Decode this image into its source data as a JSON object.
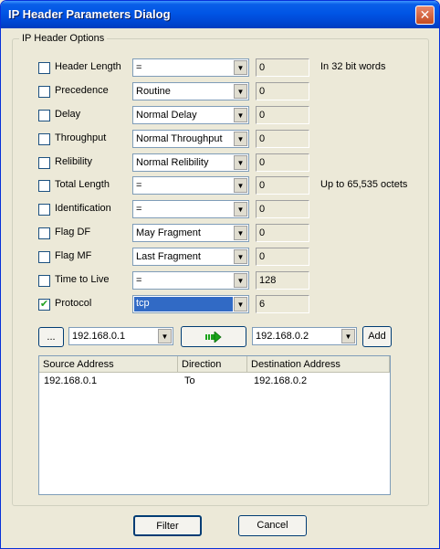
{
  "window": {
    "title": "IP Header Parameters Dialog",
    "close_glyph": "✕"
  },
  "group": {
    "label": "IP Header Options"
  },
  "fields": [
    {
      "label": "Header Length",
      "checked": false,
      "combo": "=",
      "value": "0",
      "note": "In 32 bit words"
    },
    {
      "label": "Precedence",
      "checked": false,
      "combo": "Routine",
      "value": "0",
      "note": ""
    },
    {
      "label": "Delay",
      "checked": false,
      "combo": "Normal Delay",
      "value": "0",
      "note": ""
    },
    {
      "label": "Throughput",
      "checked": false,
      "combo": "Normal Throughput",
      "value": "0",
      "note": ""
    },
    {
      "label": "Relibility",
      "checked": false,
      "combo": "Normal Relibility",
      "value": "0",
      "note": ""
    },
    {
      "label": "Total Length",
      "checked": false,
      "combo": "=",
      "value": "0",
      "note": "Up to 65,535 octets"
    },
    {
      "label": "Identification",
      "checked": false,
      "combo": "=",
      "value": "0",
      "note": ""
    },
    {
      "label": "Flag DF",
      "checked": false,
      "combo": "May Fragment",
      "value": "0",
      "note": ""
    },
    {
      "label": "Flag MF",
      "checked": false,
      "combo": "Last Fragment",
      "value": "0",
      "note": ""
    },
    {
      "label": "Time to Live",
      "checked": false,
      "combo": "=",
      "value": "128",
      "note": ""
    },
    {
      "label": "Protocol",
      "checked": true,
      "combo": "tcp",
      "value": "6",
      "note": ""
    }
  ],
  "address_bar": {
    "browse_label": "...",
    "source": "192.168.0.1",
    "direction_icon": "arrow-right-icon",
    "destination": "192.168.0.2",
    "add_label": "Add"
  },
  "table": {
    "columns": [
      "Source Address",
      "Direction",
      "Destination Address"
    ],
    "rows": [
      [
        "192.168.0.1",
        "To",
        "192.168.0.2"
      ]
    ]
  },
  "buttons": {
    "filter": "Filter",
    "cancel": "Cancel"
  },
  "colors": {
    "titlebar": "#0055e5",
    "selection": "#316ac5",
    "arrow": "#1aa31a"
  }
}
